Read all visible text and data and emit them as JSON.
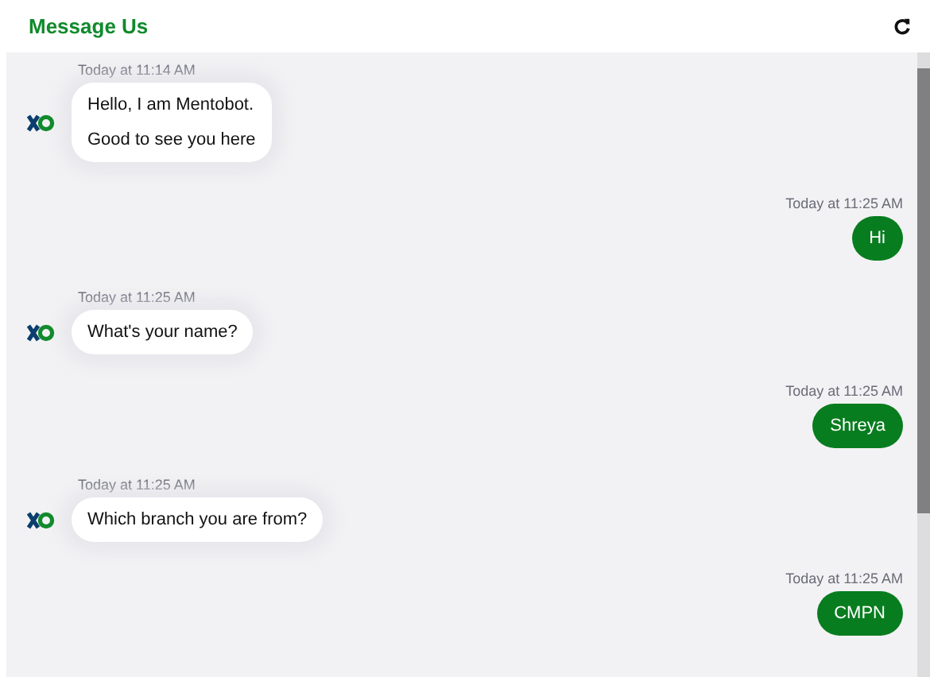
{
  "header": {
    "title": "Message Us"
  },
  "messages": [
    {
      "kind": "bot",
      "time": "Today at 11:14 AM",
      "lines": [
        "Hello, I am Mentobot.",
        "Good to see you here"
      ]
    },
    {
      "kind": "user",
      "time": "Today at 11:25 AM",
      "lines": [
        "Hi"
      ]
    },
    {
      "kind": "bot",
      "time": "Today at 11:25 AM",
      "lines": [
        "What's your name?"
      ]
    },
    {
      "kind": "user",
      "time": "Today at 11:25 AM",
      "lines": [
        "Shreya"
      ]
    },
    {
      "kind": "bot",
      "time": "Today at 11:25 AM",
      "lines": [
        "Which branch you are from?"
      ]
    },
    {
      "kind": "user",
      "time": "Today at 11:25 AM",
      "lines": [
        "CMPN"
      ]
    }
  ]
}
